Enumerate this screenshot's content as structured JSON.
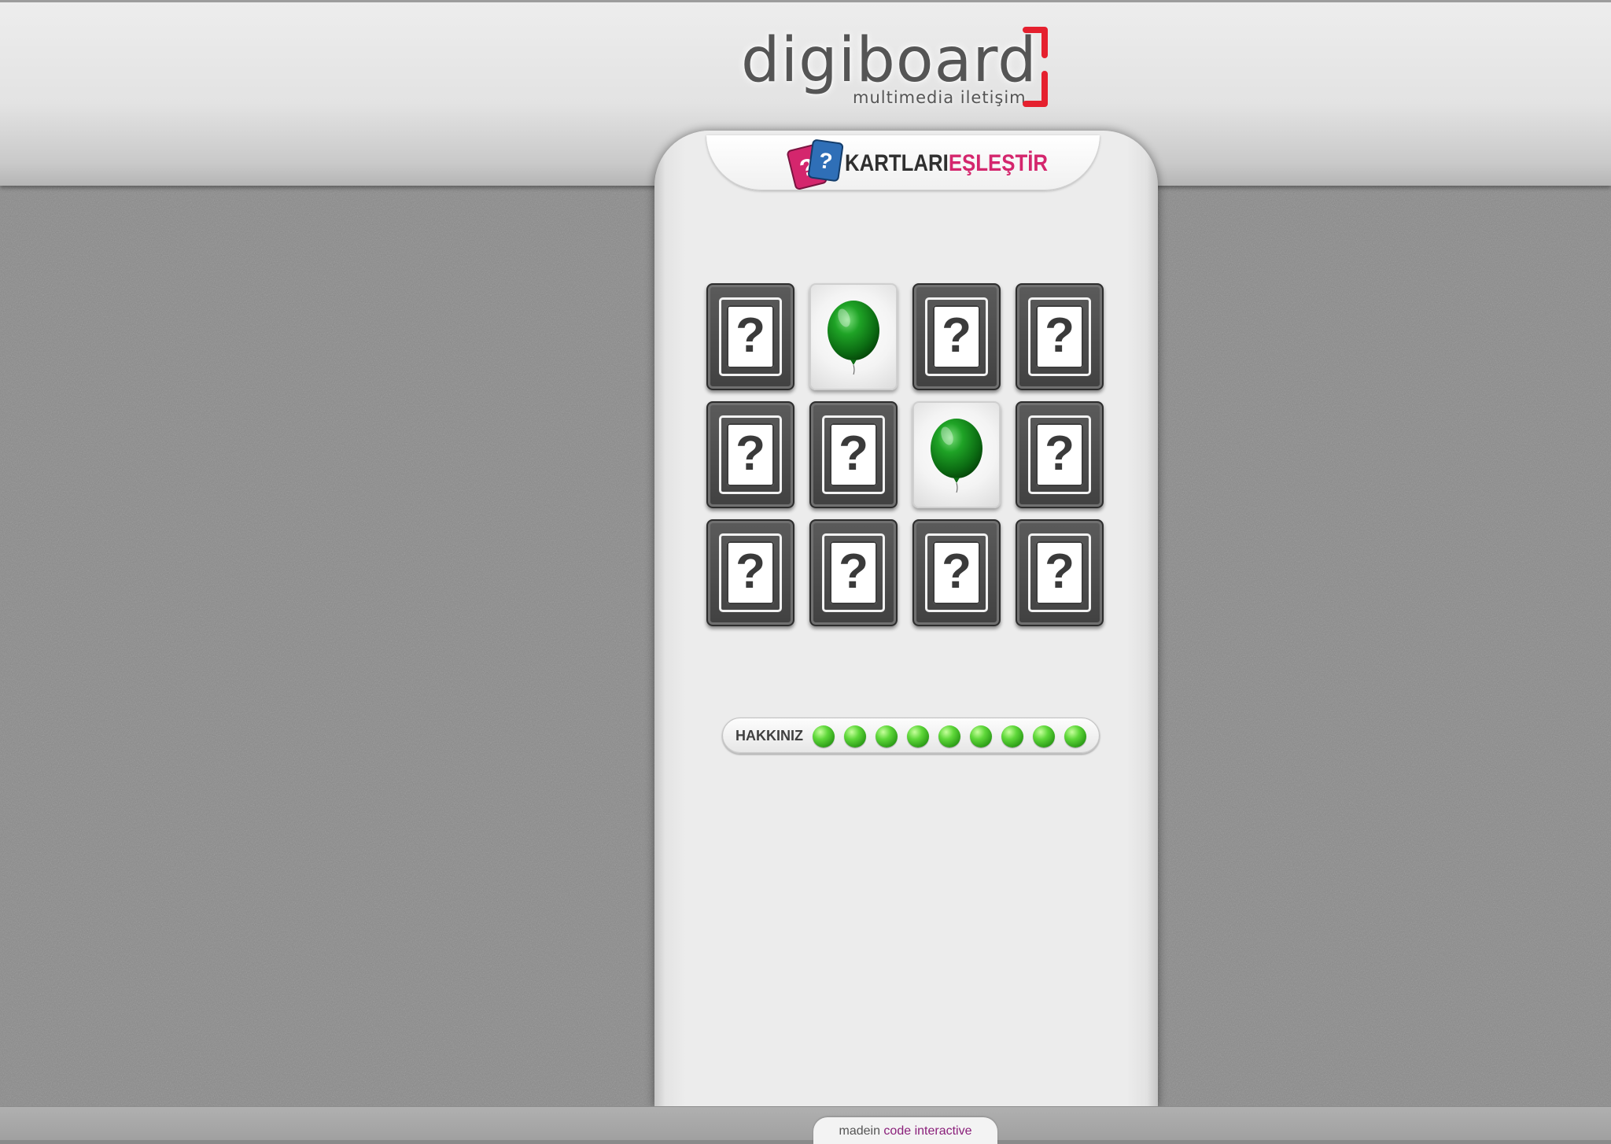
{
  "brand": {
    "logo_word": "digiboard",
    "logo_tagline": "multimedia iletişim",
    "accent_color": "#e5202e"
  },
  "game": {
    "title_part1": "KARTLARI",
    "title_part2": "EŞLEŞTİR",
    "title_colors": [
      "#2f2f2f",
      "#d4266d"
    ],
    "card_back_symbol": "?",
    "cards": [
      {
        "state": "hidden",
        "face": "question-mark"
      },
      {
        "state": "revealed",
        "face": "green-balloon-icon"
      },
      {
        "state": "hidden",
        "face": "question-mark"
      },
      {
        "state": "hidden",
        "face": "question-mark"
      },
      {
        "state": "hidden",
        "face": "question-mark"
      },
      {
        "state": "hidden",
        "face": "question-mark"
      },
      {
        "state": "revealed",
        "face": "green-balloon-icon"
      },
      {
        "state": "hidden",
        "face": "question-mark"
      },
      {
        "state": "hidden",
        "face": "question-mark"
      },
      {
        "state": "hidden",
        "face": "question-mark"
      },
      {
        "state": "hidden",
        "face": "question-mark"
      },
      {
        "state": "hidden",
        "face": "question-mark"
      }
    ],
    "lives_label": "HAKKINIZ",
    "lives_remaining": 9,
    "life_color": "#3fbf22"
  },
  "footer": {
    "made_prefix": "madein ",
    "made_brand": "code interactive"
  }
}
